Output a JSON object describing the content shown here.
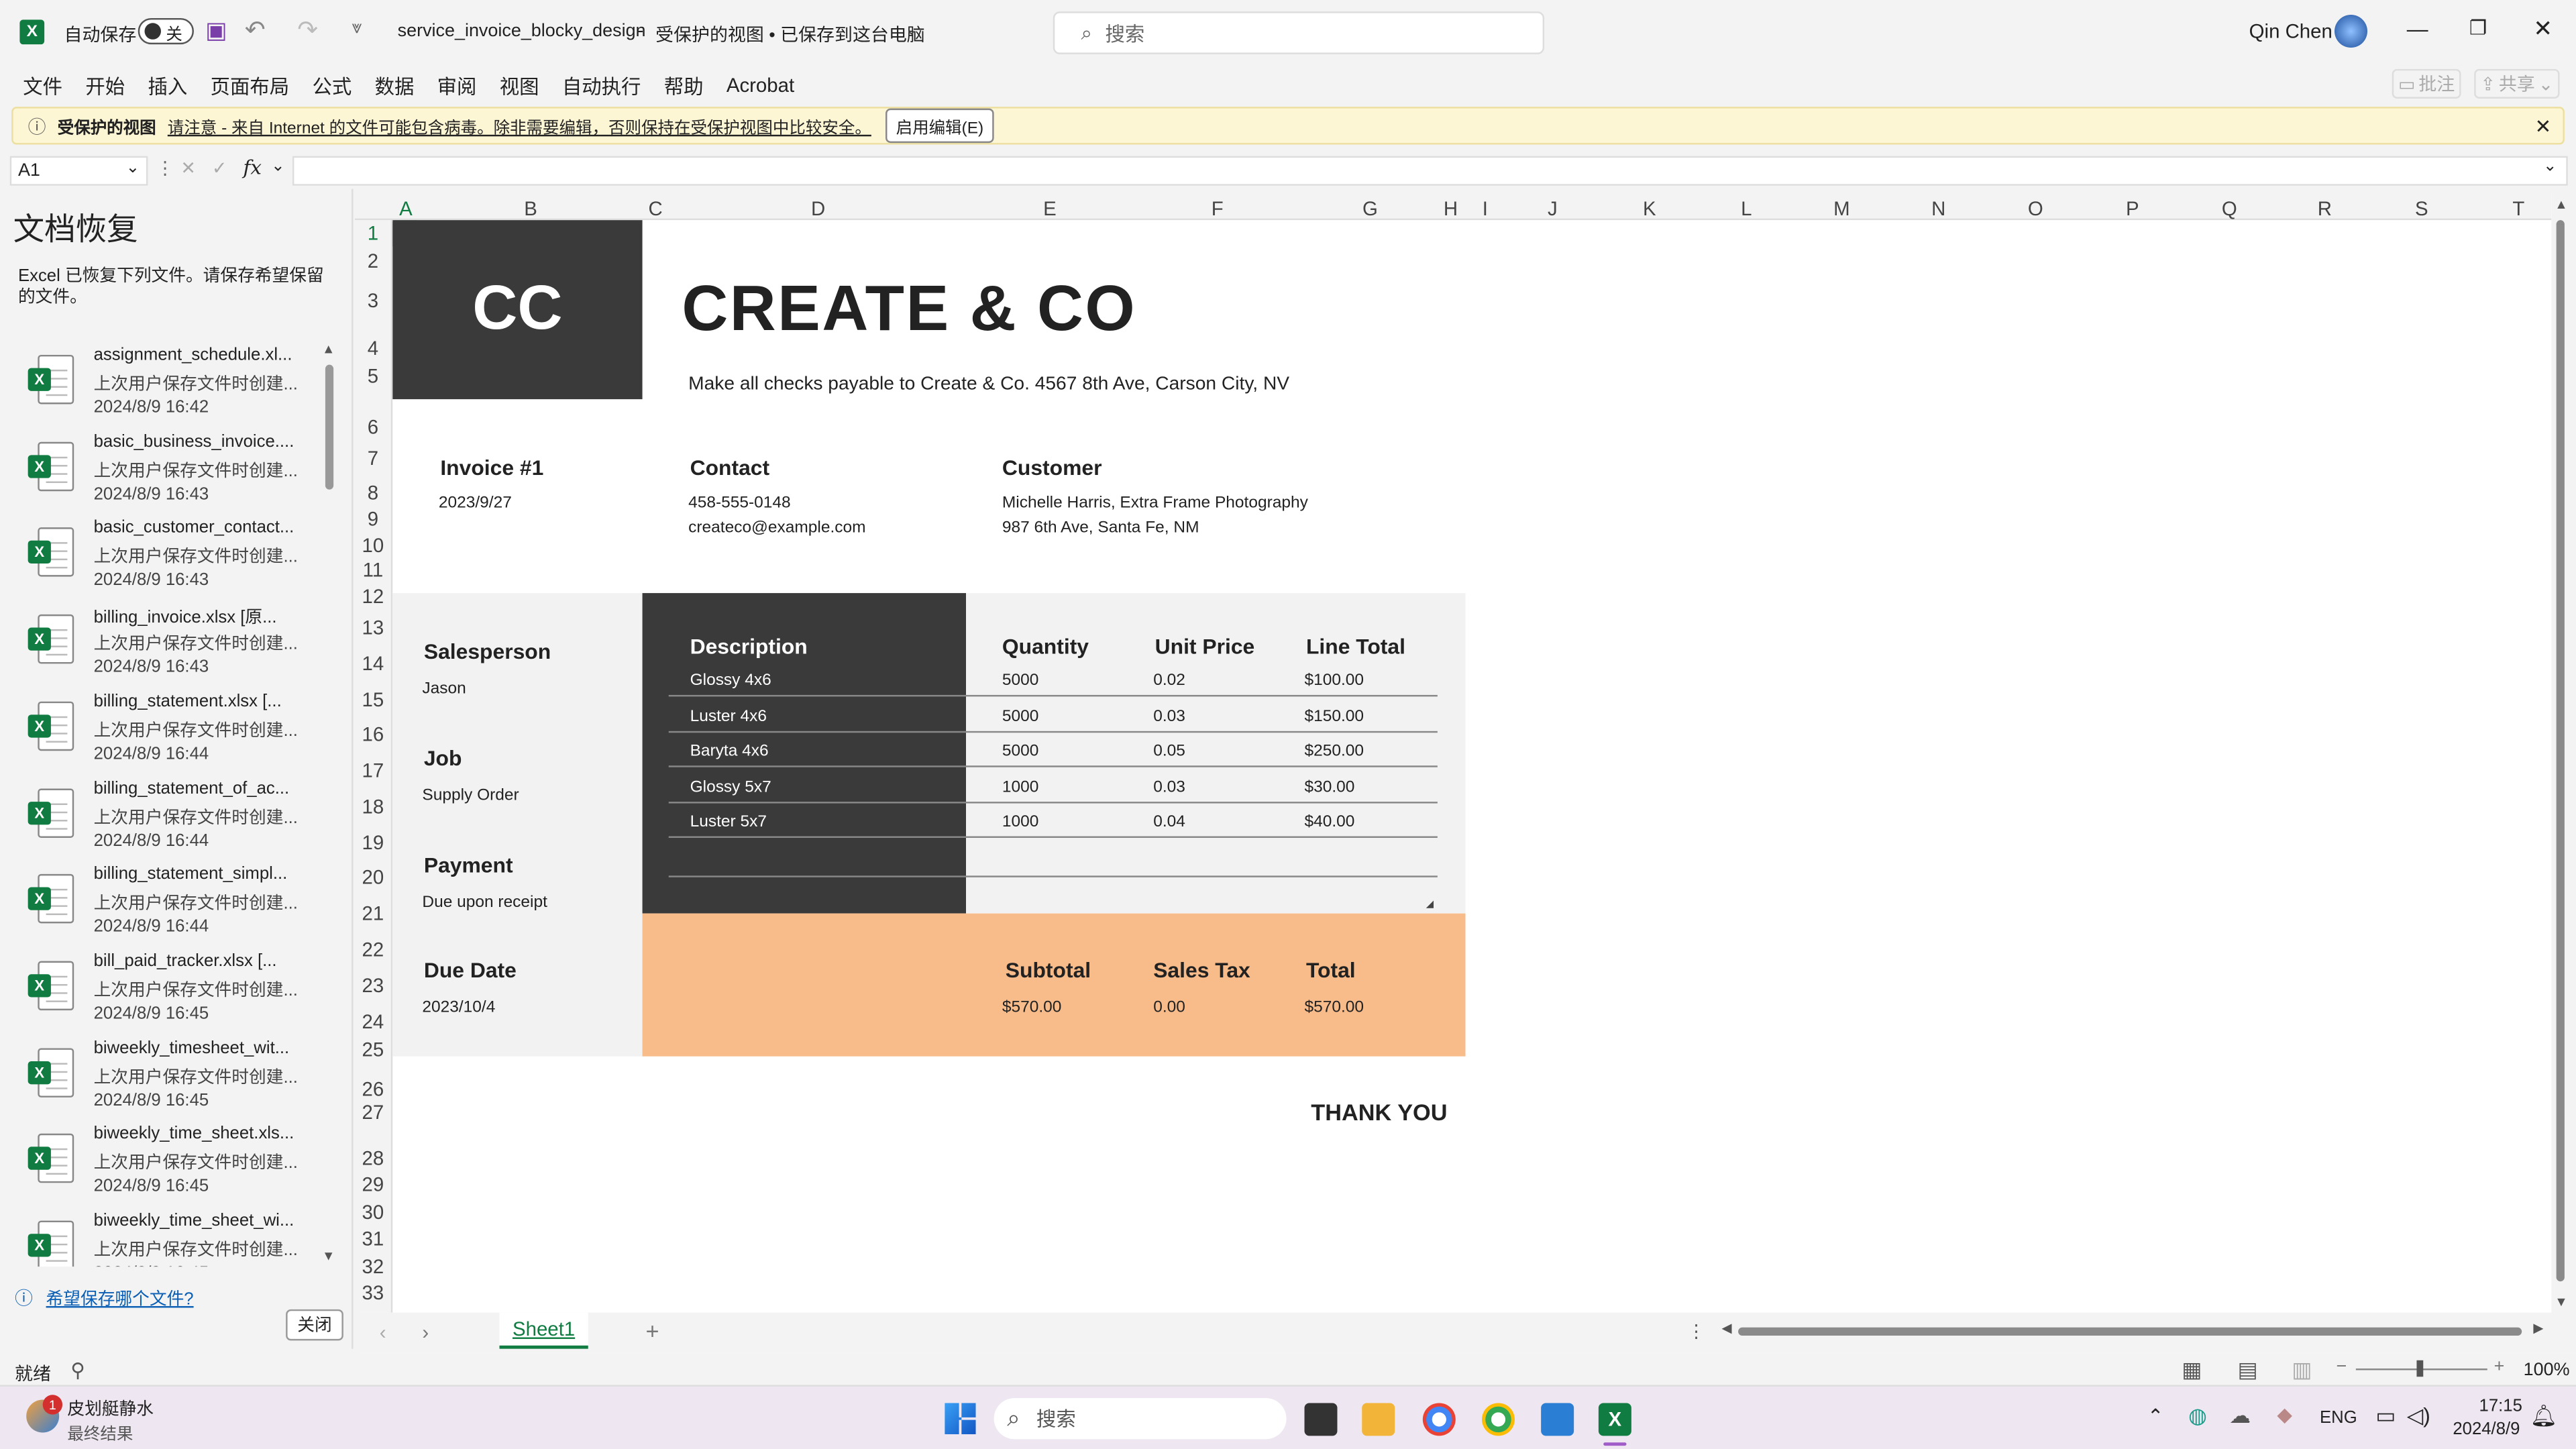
{
  "titlebar": {
    "autosave": "自动保存",
    "toggle": "关",
    "filename": "service_invoice_blocky_design",
    "sep": "-",
    "status": "受保护的视图 • 已保存到这台电脑",
    "search": "搜索",
    "user": "Qin Chen",
    "comment": "批注",
    "share": "共享"
  },
  "menu": [
    "文件",
    "开始",
    "插入",
    "页面布局",
    "公式",
    "数据",
    "审阅",
    "视图",
    "自动执行",
    "帮助",
    "Acrobat"
  ],
  "protected": {
    "title": "受保护的视图",
    "msg": "请注意 - 来自 Internet 的文件可能包含病毒。除非需要编辑，否则保持在受保护视图中比较安全。",
    "btn": "启用编辑(E)"
  },
  "formula": {
    "cell": "A1",
    "fx": "fx"
  },
  "pane": {
    "title": "文档恢复",
    "desc": "Excel 已恢复下列文件。请保存希望保留的文件。",
    "link": "希望保存哪个文件?",
    "close": "关闭",
    "items": [
      {
        "name": "assignment_schedule.xl...",
        "sub": "上次用户保存文件时创建...",
        "time": "2024/8/9 16:42"
      },
      {
        "name": "basic_business_invoice....",
        "sub": "上次用户保存文件时创建...",
        "time": "2024/8/9 16:43"
      },
      {
        "name": "basic_customer_contact...",
        "sub": "上次用户保存文件时创建...",
        "time": "2024/8/9 16:43"
      },
      {
        "name": "billing_invoice.xlsx  [原...",
        "sub": "上次用户保存文件时创建...",
        "time": "2024/8/9 16:43"
      },
      {
        "name": "billing_statement.xlsx  [...",
        "sub": "上次用户保存文件时创建...",
        "time": "2024/8/9 16:44"
      },
      {
        "name": "billing_statement_of_ac...",
        "sub": "上次用户保存文件时创建...",
        "time": "2024/8/9 16:44"
      },
      {
        "name": "billing_statement_simpl...",
        "sub": "上次用户保存文件时创建...",
        "time": "2024/8/9 16:44"
      },
      {
        "name": "bill_paid_tracker.xlsx  [...",
        "sub": "上次用户保存文件时创建...",
        "time": "2024/8/9 16:45"
      },
      {
        "name": "biweekly_timesheet_wit...",
        "sub": "上次用户保存文件时创建...",
        "time": "2024/8/9 16:45"
      },
      {
        "name": "biweekly_time_sheet.xls...",
        "sub": "上次用户保存文件时创建...",
        "time": "2024/8/9 16:45"
      },
      {
        "name": "biweekly_time_sheet_wi...",
        "sub": "上次用户保存文件时创建...",
        "time": "2024/8/9 16:45"
      }
    ]
  },
  "columns": [
    "A",
    "B",
    "C",
    "D",
    "E",
    "F",
    "G",
    "H",
    "I",
    "J",
    "K",
    "L",
    "M",
    "N",
    "O",
    "P",
    "Q",
    "R",
    "S",
    "T"
  ],
  "rows": [
    "1",
    "2",
    "3",
    "4",
    "5",
    "6",
    "7",
    "8",
    "9",
    "10",
    "11",
    "12",
    "13",
    "14",
    "15",
    "16",
    "17",
    "18",
    "19",
    "20",
    "21",
    "22",
    "23",
    "24",
    "25",
    "26",
    "27",
    "28",
    "29",
    "30",
    "31",
    "32",
    "33"
  ],
  "invoice": {
    "logo": "CC",
    "company": "CREATE & CO",
    "payable": "Make all checks payable to Create & Co. 4567 8th Ave, Carson City, NV",
    "inv_label": "Invoice #1",
    "inv_date": "2023/9/27",
    "contact_label": "Contact",
    "phone": "458-555-0148",
    "email": "createco@example.com",
    "customer_label": "Customer",
    "customer_name": "Michelle Harris, Extra Frame Photography",
    "customer_addr": "987 6th Ave, Santa Fe, NM",
    "salesperson_label": "Salesperson",
    "salesperson": "Jason",
    "job_label": "Job",
    "job": "Supply Order",
    "payment_label": "Payment",
    "payment": "Due upon receipt",
    "due_label": "Due Date",
    "due": "2023/10/4",
    "headers": {
      "desc": "Description",
      "qty": "Quantity",
      "price": "Unit Price",
      "total": "Line Total"
    },
    "items": [
      {
        "desc": "Glossy 4x6",
        "qty": "5000",
        "price": "0.02",
        "total": "$100.00"
      },
      {
        "desc": "Luster 4x6",
        "qty": "5000",
        "price": "0.03",
        "total": "$150.00"
      },
      {
        "desc": "Baryta 4x6",
        "qty": "5000",
        "price": "0.05",
        "total": "$250.00"
      },
      {
        "desc": "Glossy 5x7",
        "qty": "1000",
        "price": "0.03",
        "total": "$30.00"
      },
      {
        "desc": "Luster 5x7",
        "qty": "1000",
        "price": "0.04",
        "total": "$40.00"
      }
    ],
    "subtotal_label": "Subtotal",
    "subtotal": "$570.00",
    "tax_label": "Sales Tax",
    "tax": "0.00",
    "total_label": "Total",
    "total": "$570.00",
    "thanks": "THANK YOU"
  },
  "sheet_tab": "Sheet1",
  "status": {
    "ready": "就绪",
    "zoom": "100%"
  },
  "taskbar": {
    "weather": "皮划艇静水",
    "weather_sub": "最终结果",
    "search": "搜索",
    "lang": "ENG",
    "time": "17:15",
    "date": "2024/8/9"
  },
  "colors": {
    "dark": "#3a3a3a",
    "panel": "#f2f2f2",
    "orange": "#f8bb8a",
    "accent": "#107c41"
  }
}
